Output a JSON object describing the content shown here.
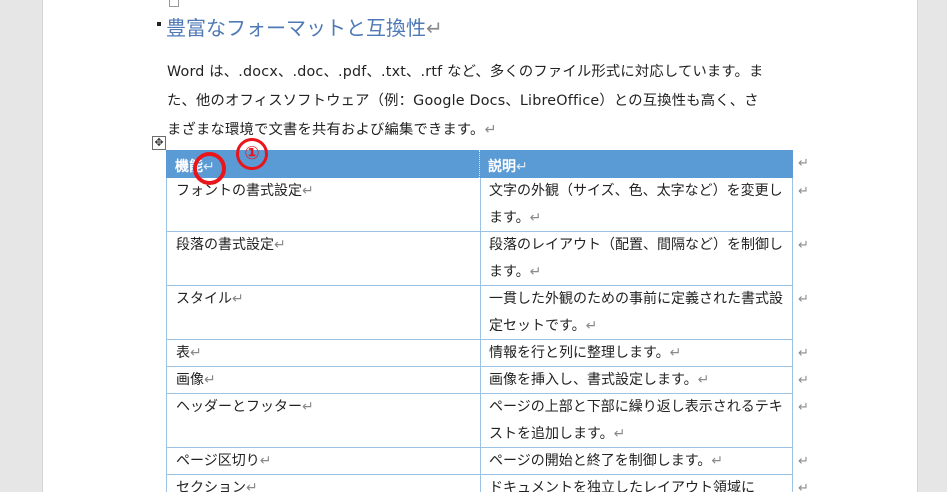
{
  "document": {
    "heading": "豊富なフォーマットと互換性",
    "paragraph_lines": [
      "Word は、.docx、.doc、.pdf、.txt、.rtf など、多くのファイル形式に対応しています。ま",
      "た、他のオフィスソフトウェア（例：Google Docs、LibreOffice）との互換性も高く、さ",
      "まざまな環境で文書を共有および編集できます。"
    ],
    "paragraph_mark": "↵",
    "table_move_handle": "✥",
    "table": {
      "headers": [
        "機能",
        "説明"
      ],
      "rows": [
        {
          "feature": "フォントの書式設定",
          "desc": "文字の外観（サイズ、色、太字など）を変更します。"
        },
        {
          "feature": "段落の書式設定",
          "desc": "段落のレイアウト（配置、間隔など）を制御します。"
        },
        {
          "feature": "スタイル",
          "desc": "一貫した外観のための事前に定義された書式設定セットです。"
        },
        {
          "feature": "表",
          "desc": "情報を行と列に整理します。"
        },
        {
          "feature": "画像",
          "desc": "画像を挿入し、書式設定します。"
        },
        {
          "feature": "ヘッダーとフッター",
          "desc": "ページの上部と下部に繰り返し表示されるテキストを追加します。"
        },
        {
          "feature": "ページ区切り",
          "desc": "ページの開始と終了を制御します。"
        },
        {
          "feature": "セクション",
          "desc": "ドキュメントを独立したレイアウト領域に"
        }
      ]
    }
  },
  "annotation": {
    "number": "①",
    "color": "#e8161c"
  },
  "colors": {
    "heading": "#4f7ab6",
    "table_header": "#5b9bd5",
    "table_border": "#9cc2e5"
  }
}
